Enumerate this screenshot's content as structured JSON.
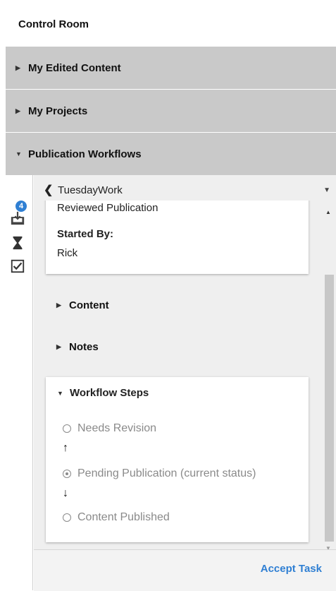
{
  "title": "Control Room",
  "sections": [
    {
      "label": "My Edited Content"
    },
    {
      "label": "My Projects"
    },
    {
      "label": "Publication Workflows"
    }
  ],
  "rail": {
    "badge_count": "4",
    "icons": [
      "inbox-download-icon",
      "hourglass-icon",
      "checkbox-icon"
    ]
  },
  "workflow": {
    "name": "TuesdayWork",
    "card": {
      "cut_text": "Reviewed Publication",
      "started_by_label": "Started By:",
      "started_by_value": "Rick"
    },
    "content_label": "Content",
    "notes_label": "Notes",
    "steps_label": "Workflow Steps",
    "steps": [
      {
        "label": "Needs Revision",
        "checked": false
      },
      {
        "label": "Pending Publication (current status)",
        "checked": true
      },
      {
        "label": "Content Published",
        "checked": false
      }
    ],
    "accept_label": "Accept Task"
  },
  "colors": {
    "accent": "#2f7fd3",
    "header_bg": "#c9c9c9",
    "panel_bg": "#efefef"
  }
}
